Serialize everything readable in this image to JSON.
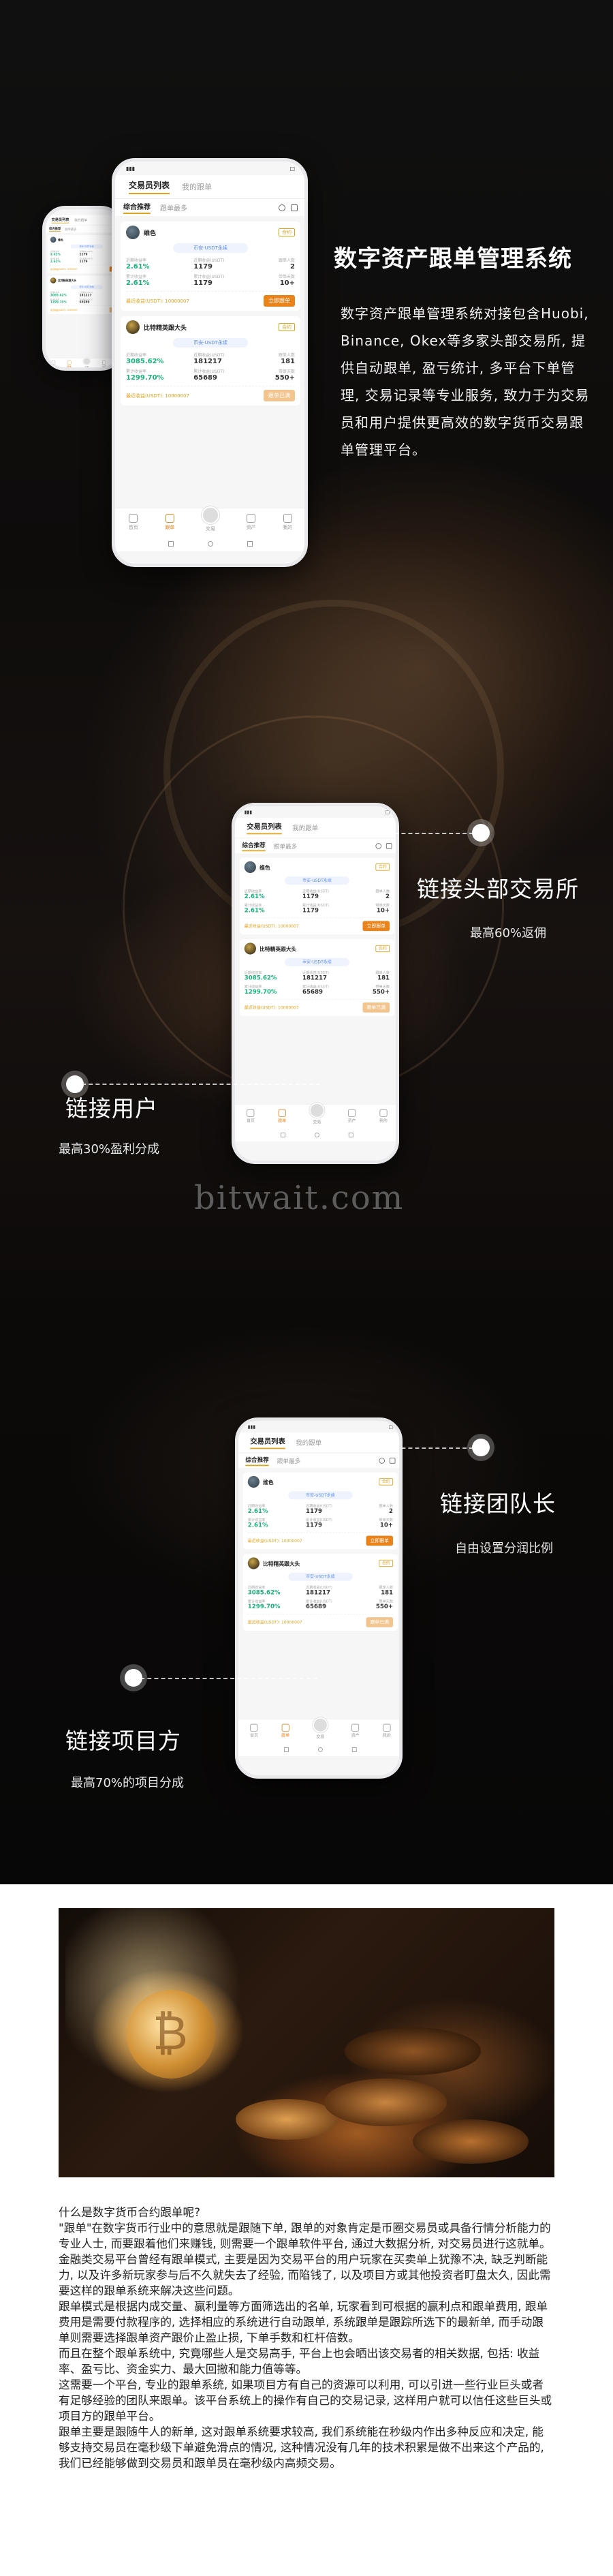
{
  "brand": {
    "accent": "#e9831a",
    "tab_underline": "#e3a019",
    "green": "#19b07b"
  },
  "hero": {
    "title": "数字资产跟单管理系统",
    "description": "数字资产跟单管理系统对接包含Huobi, Binance, Okex等多家头部交易所, 提供自动跟单, 盈亏统计, 多平台下单管理, 交易记录等专业服务, 致力于为交易员和用户提供更高效的数字货币交易跟单管理平台。"
  },
  "features": [
    {
      "title": "链接头部交易所",
      "subtitle": "最高60%返佣"
    },
    {
      "title": "链接用户",
      "subtitle": "最高30%盈利分成"
    },
    {
      "title": "链接团队长",
      "subtitle": "自由设置分润比例"
    },
    {
      "title": "链接项目方",
      "subtitle": "最高70%的项目分成"
    }
  ],
  "watermark": "bitwait.com",
  "app": {
    "header_tabs": [
      "交易员列表",
      "我的跟单"
    ],
    "sub_tabs": [
      "综合推荐",
      "跟单最多"
    ],
    "strategy_label": "币安-USDT永续",
    "cards": [
      {
        "name": "维色",
        "tag": "合约",
        "stats": [
          {
            "label": "近期收益率",
            "value": "2.61%"
          },
          {
            "label": "近期收益(USDT)",
            "value": "1179"
          },
          {
            "label": "跟单人数",
            "value": "2"
          },
          {
            "label": "累计收益率",
            "value": "2.61%"
          },
          {
            "label": "累计收益(USDT)",
            "value": "1179"
          },
          {
            "label": "带单天数",
            "value": "10+"
          }
        ],
        "footer": "最近收益(USDT): 10000007",
        "button": "立即跟单"
      },
      {
        "name": "比特精英跟大头",
        "tag": "合约",
        "stats": [
          {
            "label": "近期收益率",
            "value": "3085.62%"
          },
          {
            "label": "近期收益(USDT)",
            "value": "181217"
          },
          {
            "label": "跟单人数",
            "value": "181"
          },
          {
            "label": "累计收益率",
            "value": "1299.70%"
          },
          {
            "label": "累计收益(USDT)",
            "value": "65689"
          },
          {
            "label": "带单天数",
            "value": "550+"
          }
        ],
        "footer": "最近收益(USDT): 10000007",
        "button": "跟单已满"
      }
    ],
    "tabbar": [
      "首页",
      "跟单",
      "交易",
      "资产",
      "我的"
    ]
  },
  "article": {
    "paragraphs": [
      "什么是数字货币合约跟单呢?",
      "\"跟单\"在数字货币行业中的意思就是跟随下单, 跟单的对象肯定是币圈交易员或具备行情分析能力的专业人士, 而要跟着他们来赚钱, 则需要一个跟单软件平台, 通过大数据分析, 对交易员进行这就单。金融类交易平台曾经有跟单模式, 主要是因为交易平台的用户玩家在买卖单上犹豫不决, 缺乏判断能力, 以及许多新玩家参与后不久就失去了经验, 而陷钱了, 以及项目方或其他投资者盯盘太久, 因此需要这样的跟单系统来解决这些问题。",
      "跟单模式是根据内成交量、赢利量等方面筛选出的名单, 玩家看到可根据的赢利点和跟单费用, 跟单费用是需要付款程序的, 选择相应的系统进行自动跟单, 系统跟单是跟踪所选下的最新单, 而手动跟单则需要选择跟单资产跟价止盈止损, 下单手数和杠杆倍数。",
      "而且在整个跟单系统中, 究竟哪些人是交易高手, 平台上也会晒出该交易者的相关数据, 包括: 收益率、盈亏比、资金实力、最大回撤和能力值等等。",
      "这需要一个平台, 专业的跟单系统, 如果项目方有自己的资源可以利用, 可以引进一些行业巨头或者有足够经验的团队来跟单。该平台系统上的操作有自己的交易记录, 这样用户就可以信任这些巨头或项目方的跟单平台。",
      "跟单主要是跟随牛人的新单, 这对跟单系统要求较高, 我们系统能在秒级内作出多种反应和决定, 能够支持交易员在毫秒级下单避免滑点的情况, 这种情况没有几年的技术积累是做不出来这个产品的, 我们已经能够做到交易员和跟单员在毫秒级内高频交易。"
    ]
  }
}
